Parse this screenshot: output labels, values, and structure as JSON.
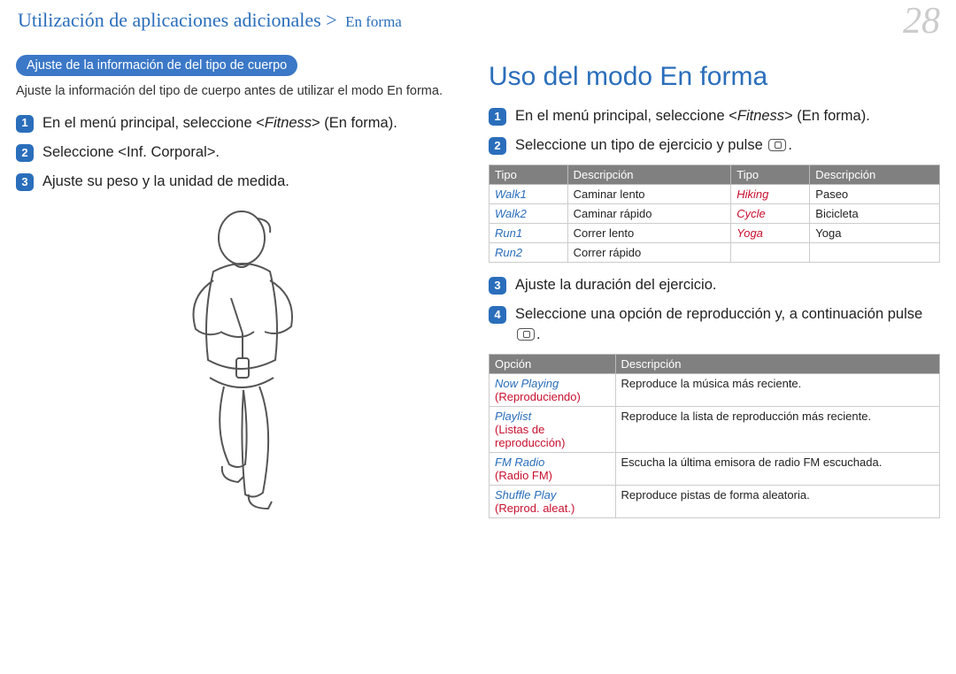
{
  "page_number": "28",
  "breadcrumb": {
    "main": "Utilización de aplicaciones adicionales",
    "sep": " > ",
    "sub": "En forma"
  },
  "left": {
    "section_title": "Ajuste de la información de del tipo de cuerpo",
    "intro": "Ajuste la información del tipo de cuerpo antes de utilizar el modo En forma.",
    "steps": {
      "s1_pre": "En el menú principal, seleccione <",
      "s1_app": "Fitness",
      "s1_post": "> (En forma).",
      "s2": "Seleccione <Inf. Corporal>.",
      "s3": "Ajuste su peso y la unidad de medida."
    }
  },
  "right": {
    "heading": "Uso del modo En forma",
    "steps": {
      "s1_pre": "En el menú principal, seleccione <",
      "s1_app": "Fitness",
      "s1_post": "> (En forma).",
      "s2_pre": "Seleccione un tipo de ejercicio y pulse ",
      "s2_post": ".",
      "s3": "Ajuste la duración del ejercicio.",
      "s4_pre": "Seleccione una opción de reproducción y, a continuación pulse ",
      "s4_post": "."
    },
    "table1": {
      "headers": [
        "Tipo",
        "Descripción",
        "Tipo",
        "Descripción"
      ],
      "rows": [
        [
          "Walk1",
          "Caminar lento",
          "Hiking",
          "Paseo"
        ],
        [
          "Walk2",
          "Caminar rápido",
          "Cycle",
          "Bicicleta"
        ],
        [
          "Run1",
          "Correr lento",
          "Yoga",
          "Yoga"
        ],
        [
          "Run2",
          "Correr rápido",
          "",
          ""
        ]
      ]
    },
    "table2": {
      "headers": [
        "Opción",
        "Descripción"
      ],
      "rows": [
        {
          "opt_it": "Now Playing",
          "opt_paren": "(Reproduciendo)",
          "desc": "Reproduce la música más reciente."
        },
        {
          "opt_it": "Playlist",
          "opt_paren": "(Listas de reproducción)",
          "desc": "Reproduce la lista de reproducción más reciente."
        },
        {
          "opt_it": "FM Radio",
          "opt_paren": "(Radio FM)",
          "desc": "Escucha la última emisora de radio FM escuchada."
        },
        {
          "opt_it": "Shuffle Play",
          "opt_paren": "(Reprod. aleat.)",
          "desc": "Reproduce pistas de forma aleatoria."
        }
      ]
    }
  }
}
